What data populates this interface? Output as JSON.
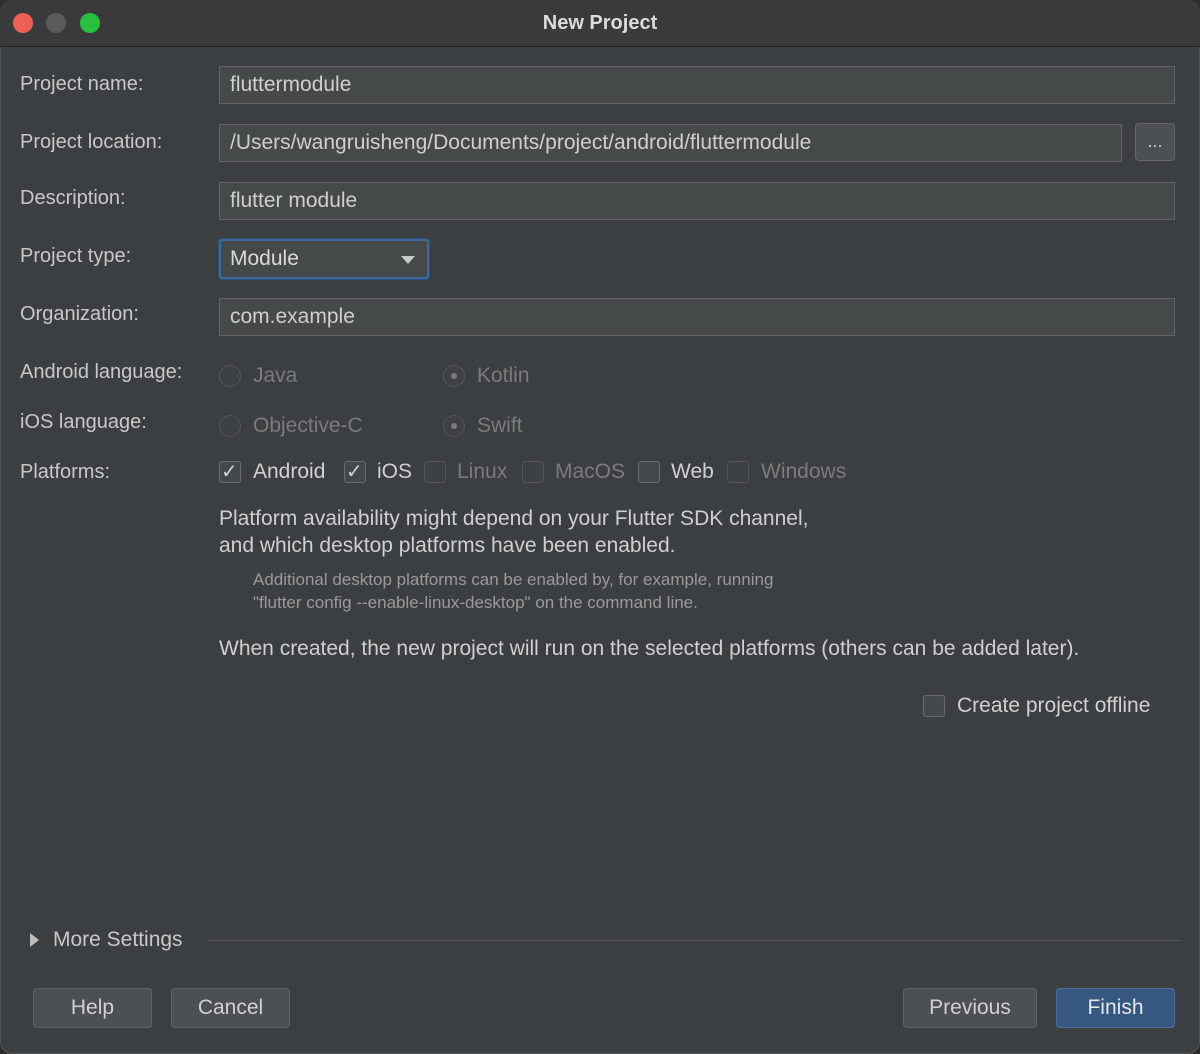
{
  "window": {
    "title": "New Project"
  },
  "form": {
    "project_name": {
      "label": "Project name:",
      "value": "fluttermodule"
    },
    "project_location": {
      "label": "Project location:",
      "value": "/Users/wangruisheng/Documents/project/android/fluttermodule",
      "browse_label": "..."
    },
    "description": {
      "label": "Description:",
      "value": "flutter module"
    },
    "project_type": {
      "label": "Project type:",
      "value": "Module"
    },
    "organization": {
      "label": "Organization:",
      "value": "com.example"
    },
    "android_language": {
      "label": "Android language:",
      "options": [
        "Java",
        "Kotlin"
      ],
      "selected": "Kotlin"
    },
    "ios_language": {
      "label": "iOS language:",
      "options": [
        "Objective-C",
        "Swift"
      ],
      "selected": "Swift"
    },
    "platforms": {
      "label": "Platforms:",
      "items": [
        {
          "label": "Android",
          "checked": true,
          "enabled": true
        },
        {
          "label": "iOS",
          "checked": true,
          "enabled": true
        },
        {
          "label": "Linux",
          "checked": false,
          "enabled": false
        },
        {
          "label": "MacOS",
          "checked": false,
          "enabled": false
        },
        {
          "label": "Web",
          "checked": false,
          "enabled": true
        },
        {
          "label": "Windows",
          "checked": false,
          "enabled": false
        }
      ]
    },
    "availability_line1": "Platform availability might depend on your Flutter SDK channel,",
    "availability_line2": "and which desktop platforms have been enabled.",
    "note_line1": "Additional desktop platforms can be enabled by, for example, running",
    "note_line2": "\"flutter config --enable-linux-desktop\" on the command line.",
    "created_text": "When created, the new project will run on the selected platforms (others can be added later).",
    "offline": {
      "label": "Create project offline",
      "checked": false
    }
  },
  "more_settings": {
    "label": "More Settings"
  },
  "buttons": {
    "help": "Help",
    "cancel": "Cancel",
    "previous": "Previous",
    "finish": "Finish"
  }
}
